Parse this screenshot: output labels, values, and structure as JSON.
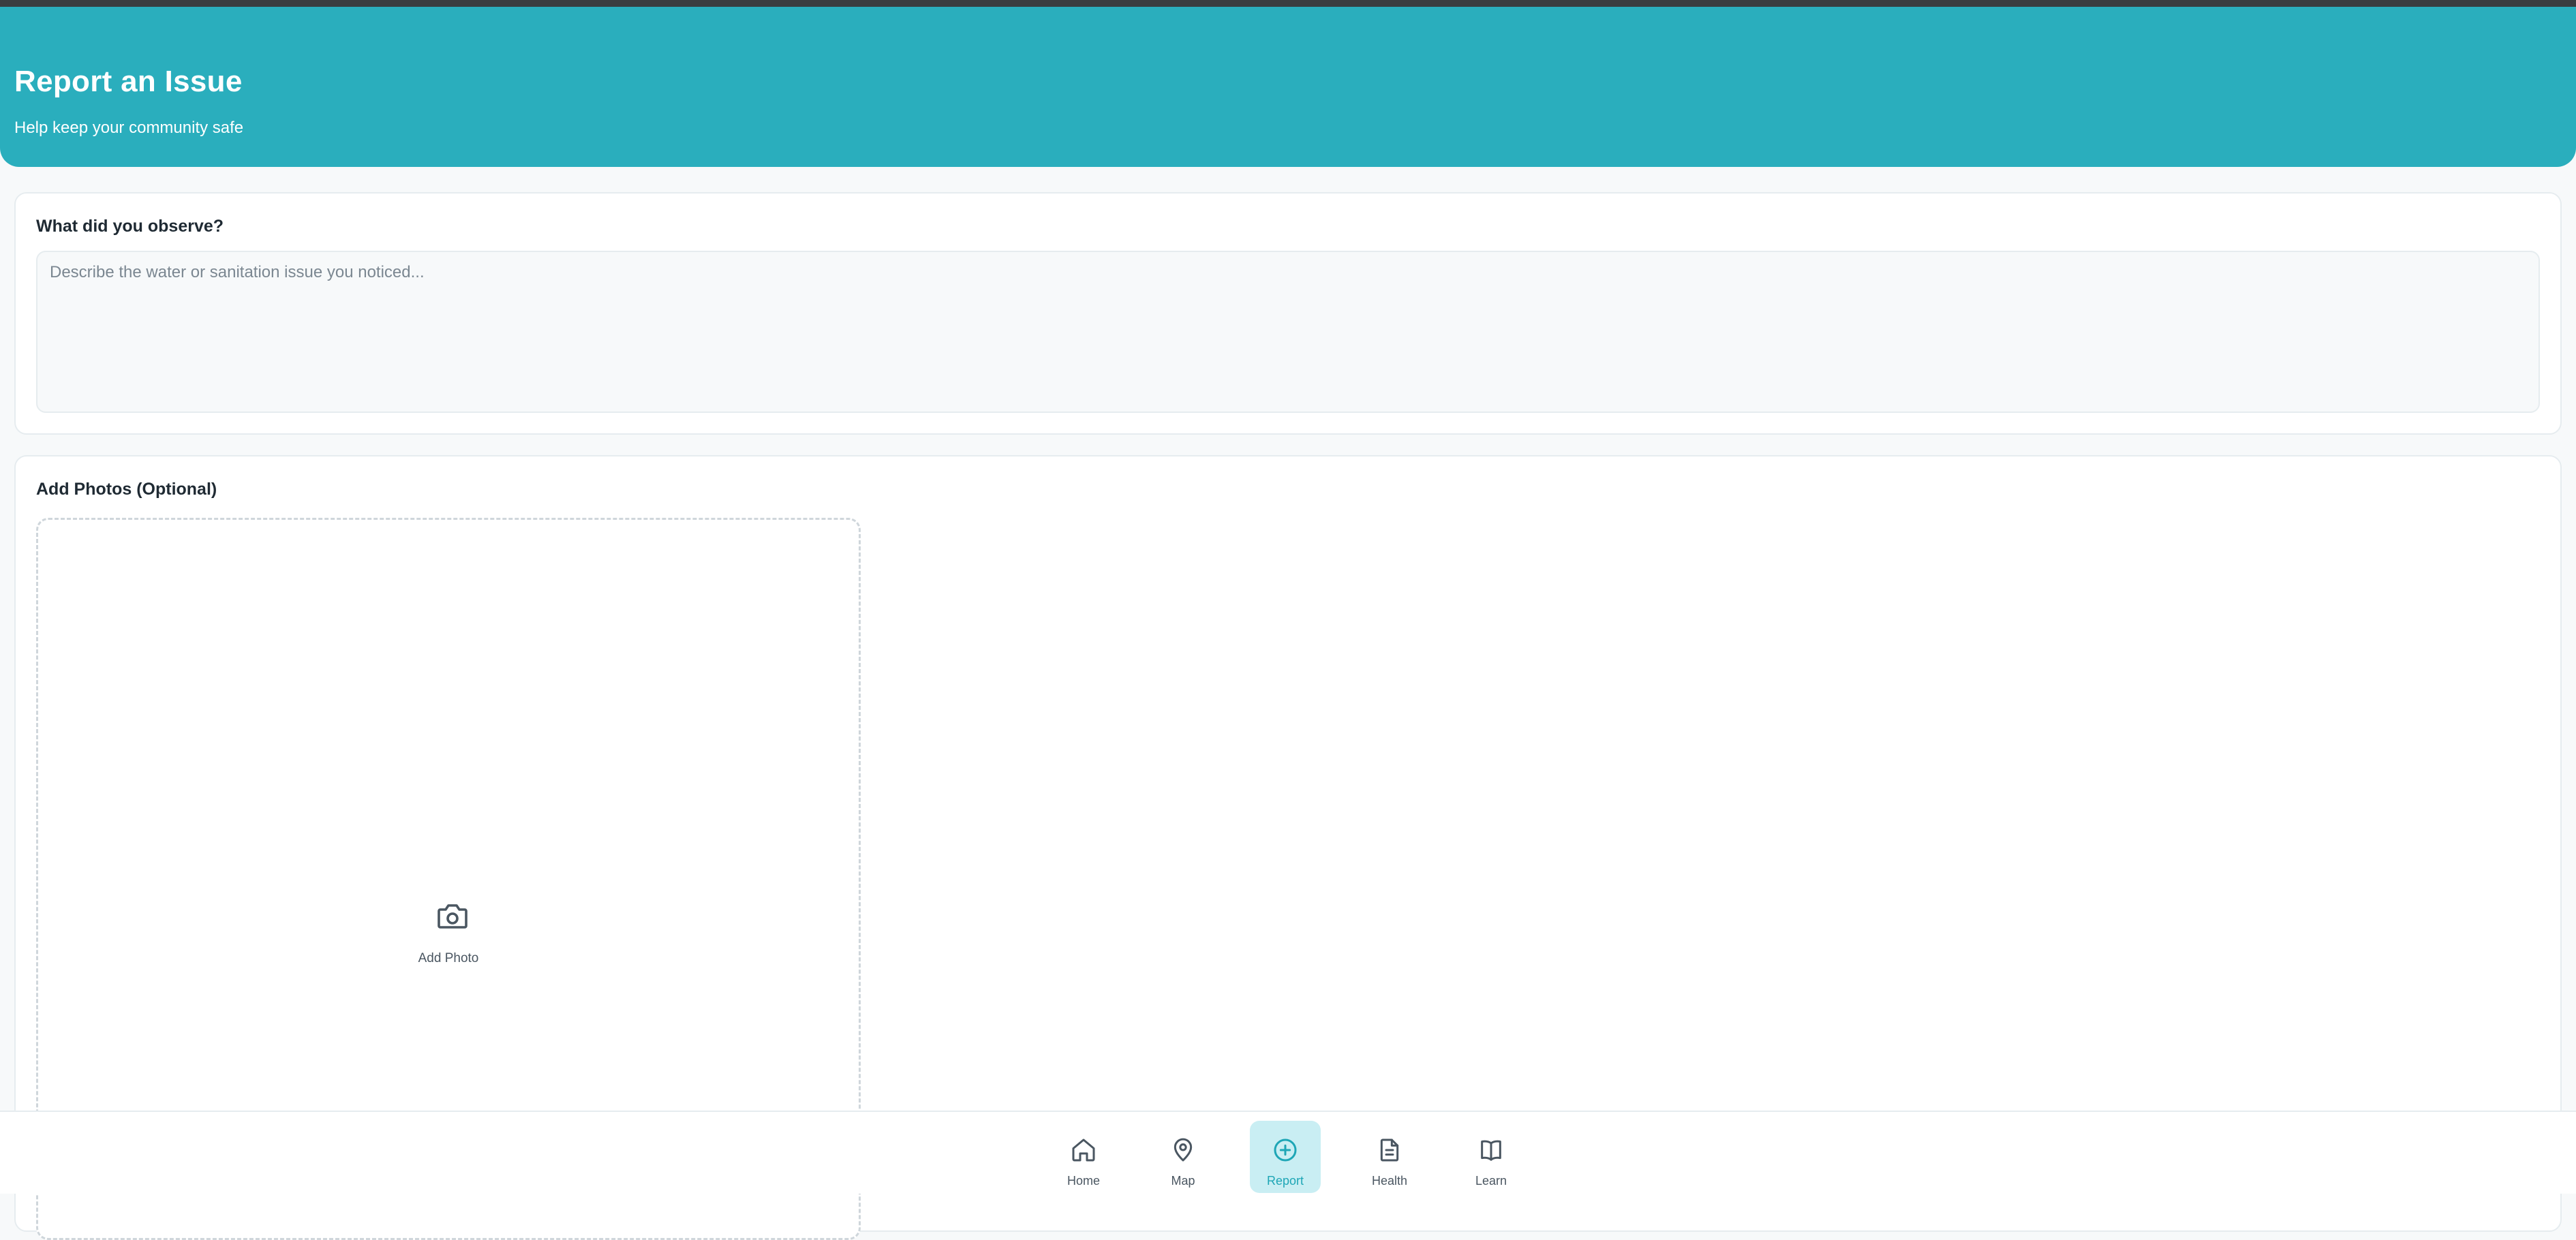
{
  "header": {
    "title": "Report an Issue",
    "subtitle": "Help keep your community safe"
  },
  "observe": {
    "label": "What did you observe?",
    "placeholder": "Describe the water or sanitation issue you noticed...",
    "value": ""
  },
  "photos": {
    "label": "Add Photos (Optional)",
    "add_photo_label": "Add Photo",
    "icon": "camera-icon"
  },
  "nav": {
    "items": [
      {
        "label": "Home",
        "icon": "home-icon",
        "active": false
      },
      {
        "label": "Map",
        "icon": "map-pin-icon",
        "active": false
      },
      {
        "label": "Report",
        "icon": "plus-circle-icon",
        "active": true
      },
      {
        "label": "Health",
        "icon": "document-icon",
        "active": false
      },
      {
        "label": "Learn",
        "icon": "book-icon",
        "active": false
      }
    ]
  },
  "colors": {
    "brand": "#2aaebd",
    "active_nav_bg": "#c9eef3",
    "active_nav_text": "#1ea6b6"
  }
}
